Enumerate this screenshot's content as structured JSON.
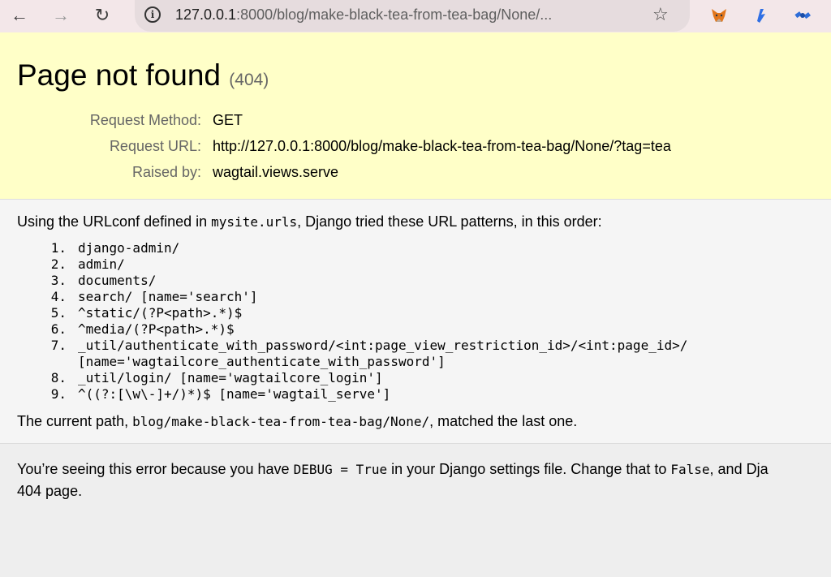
{
  "browser": {
    "url_host": "127.0.0.1",
    "url_rest": ":8000/blog/make-black-tea-from-tea-bag/None/..."
  },
  "summary": {
    "title": "Page not found",
    "status_code": "(404)",
    "rows": [
      {
        "key": "Request Method:",
        "value": "GET"
      },
      {
        "key": "Request URL:",
        "value": "http://127.0.0.1:8000/blog/make-black-tea-from-tea-bag/None/?tag=tea"
      },
      {
        "key": "Raised by:",
        "value": "wagtail.views.serve"
      }
    ]
  },
  "info": {
    "intro_before": "Using the URLconf defined in ",
    "intro_module": "mysite.urls",
    "intro_after": ", Django tried these URL patterns, in this order:",
    "patterns": [
      {
        "num": "1.",
        "text": "django-admin/"
      },
      {
        "num": "2.",
        "text": "admin/"
      },
      {
        "num": "3.",
        "text": "documents/"
      },
      {
        "num": "4.",
        "text": "search/ [name='search']"
      },
      {
        "num": "5.",
        "text": "^static/(?P<path>.*)$"
      },
      {
        "num": "6.",
        "text": "^media/(?P<path>.*)$"
      },
      {
        "num": "7.",
        "text": "_util/authenticate_with_password/<int:page_view_restriction_id>/<int:page_id>/\n[name='wagtailcore_authenticate_with_password']"
      },
      {
        "num": "8.",
        "text": "_util/login/ [name='wagtailcore_login']"
      },
      {
        "num": "9.",
        "text": "^((?:[\\w\\-]+/)*)$ [name='wagtail_serve']"
      }
    ],
    "current_before": "The current path, ",
    "current_path": "blog/make-black-tea-from-tea-bag/None/",
    "current_after": ", matched the last one."
  },
  "explanation": {
    "part1": "You’re seeing this error because you have ",
    "debug_code": "DEBUG = True",
    "part2": " in your Django settings file. Change that to ",
    "false_code": "False",
    "part3": ", and Dja",
    "line2": "404 page."
  }
}
